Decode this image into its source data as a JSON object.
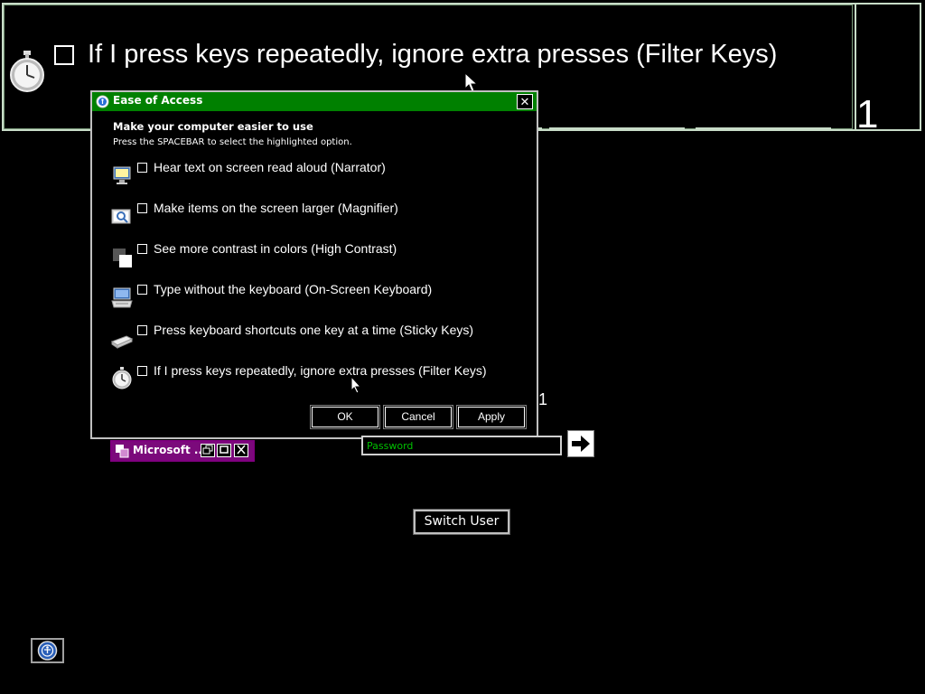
{
  "magnifier": {
    "option_label": "If I press keys repeatedly, ignore extra presses (Filter Keys)",
    "numeral": "1"
  },
  "dialog": {
    "title": "Ease of Access",
    "close_glyph": "✕",
    "heading": "Make your computer easier to use",
    "subtext": "Press the SPACEBAR to select the highlighted option.",
    "options": [
      {
        "label": "Hear text on screen read aloud (Narrator)",
        "icon": "narrator-icon",
        "checked": false
      },
      {
        "label": "Make items on the screen larger (Magnifier)",
        "icon": "magnifier-icon",
        "checked": false
      },
      {
        "label": "See more contrast in colors (High Contrast)",
        "icon": "high-contrast-icon",
        "checked": false
      },
      {
        "label": "Type without the keyboard (On-Screen Keyboard)",
        "icon": "on-screen-keyboard-icon",
        "checked": false
      },
      {
        "label": "Press keyboard shortcuts one key at a time (Sticky Keys)",
        "icon": "sticky-keys-icon",
        "checked": false
      },
      {
        "label": "If I press keys repeatedly, ignore extra presses (Filter Keys)",
        "icon": "stopwatch-icon",
        "checked": false
      }
    ],
    "buttons": {
      "ok": "OK",
      "cancel": "Cancel",
      "apply": "Apply"
    }
  },
  "behind": {
    "numeral": "1"
  },
  "ms_window": {
    "title": "Microsoft ..."
  },
  "login": {
    "password_placeholder": "Password",
    "switch_user": "Switch User"
  },
  "colors": {
    "titlebar": "#008000",
    "placeholder": "#00c000",
    "ms_window": "#800080",
    "background": "#000000"
  }
}
